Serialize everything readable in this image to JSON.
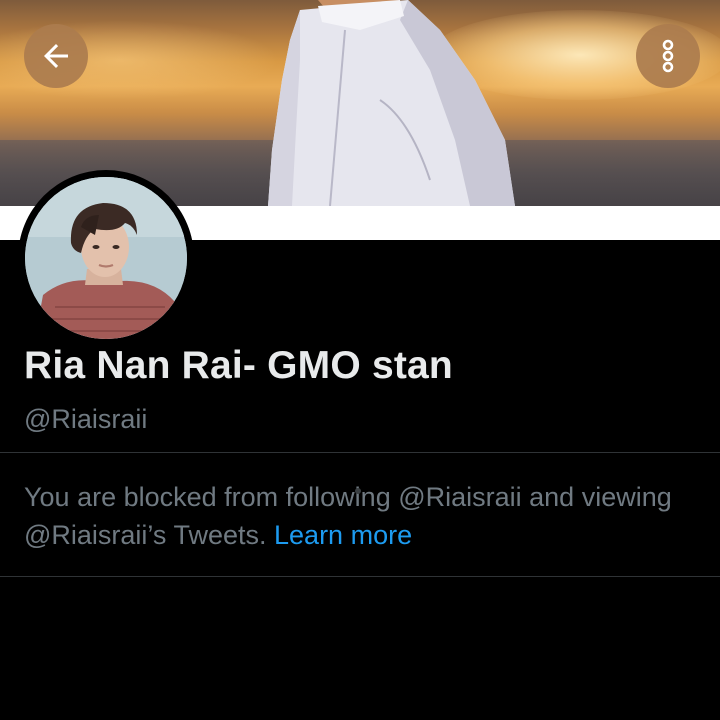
{
  "header": {
    "back_icon": "arrow-left-icon",
    "more_icon": "more-vertical-icon",
    "button_color": "#ab7c4e"
  },
  "profile": {
    "display_name": "Ria Nan Rai- GMO stan",
    "handle": "@Riaisraii"
  },
  "blocked_notice": {
    "message": "You are blocked from following @Riaisraii and viewing @Riaisraii’s Tweets.",
    "link_label": "Learn more",
    "link_color": "#1d9bf0"
  },
  "colors": {
    "background": "#000000",
    "name_text": "#e8eaeb",
    "secondary_text": "#707a82",
    "divider": "#2f3336"
  }
}
